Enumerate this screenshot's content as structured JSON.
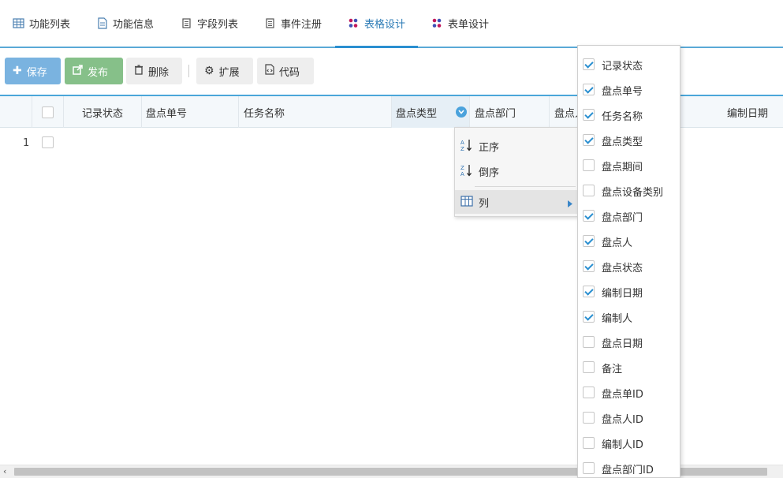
{
  "tabs": [
    {
      "label": "功能列表",
      "icon": "grid-icon"
    },
    {
      "label": "功能信息",
      "icon": "document-icon"
    },
    {
      "label": "字段列表",
      "icon": "list-icon"
    },
    {
      "label": "事件注册",
      "icon": "list-icon"
    },
    {
      "label": "表格设计",
      "icon": "dots-icon",
      "active": true
    },
    {
      "label": "表单设计",
      "icon": "dots-icon"
    }
  ],
  "toolbar": {
    "save": "保存",
    "publish": "发布",
    "delete": "删除",
    "extend": "扩展",
    "code": "代码"
  },
  "grid": {
    "headers": [
      "记录状态",
      "盘点单号",
      "任务名称",
      "盘点类型",
      "盘点部门",
      "盘点人",
      "编制日期"
    ],
    "rows": [
      {
        "num": "1"
      }
    ]
  },
  "column_menu": {
    "sort_asc": "正序",
    "sort_desc": "倒序",
    "columns": "列"
  },
  "columns_list": [
    {
      "label": "记录状态",
      "checked": true
    },
    {
      "label": "盘点单号",
      "checked": true
    },
    {
      "label": "任务名称",
      "checked": true
    },
    {
      "label": "盘点类型",
      "checked": true
    },
    {
      "label": "盘点期间",
      "checked": false
    },
    {
      "label": "盘点设备类别",
      "checked": false
    },
    {
      "label": "盘点部门",
      "checked": true
    },
    {
      "label": "盘点人",
      "checked": true
    },
    {
      "label": "盘点状态",
      "checked": true
    },
    {
      "label": "编制日期",
      "checked": true
    },
    {
      "label": "编制人",
      "checked": true
    },
    {
      "label": "盘点日期",
      "checked": false
    },
    {
      "label": "备注",
      "checked": false
    },
    {
      "label": "盘点单ID",
      "checked": false
    },
    {
      "label": "盘点人ID",
      "checked": false
    },
    {
      "label": "编制人ID",
      "checked": false
    },
    {
      "label": "盘点部门ID",
      "checked": false
    }
  ],
  "colors": {
    "accent": "#2a8fd0",
    "save_bg": "#7ab3e0",
    "publish_bg": "#86c089"
  }
}
